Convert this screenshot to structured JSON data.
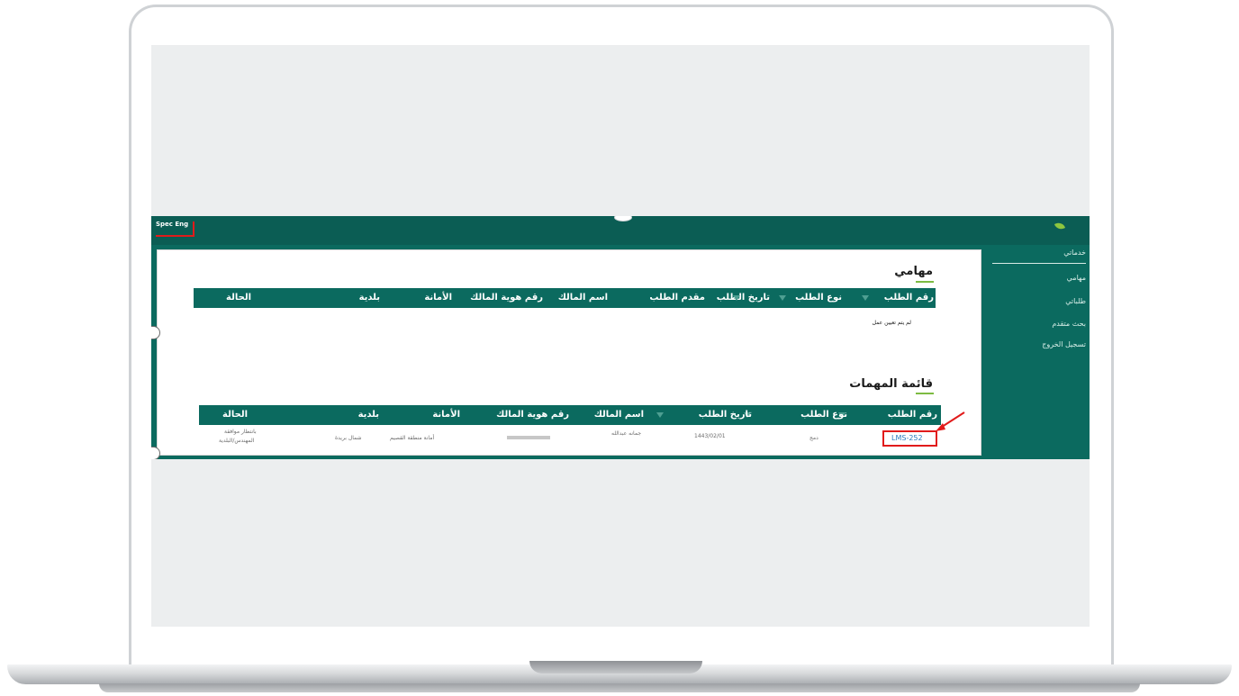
{
  "app": {
    "user_label": "Spec Eng"
  },
  "sidebar": {
    "items": [
      {
        "label": "خدماتي"
      },
      {
        "label": "مهامي"
      },
      {
        "label": "طلباتي"
      },
      {
        "label": "بحث متقدم"
      },
      {
        "label": "تسجيل الخروج"
      }
    ]
  },
  "tasks": {
    "title": "مهامي",
    "columns": [
      "رقم الطلب",
      "نوع الطلب",
      "تاريخ الطلب",
      "مقدم الطلب",
      "اسم المالك",
      "رقم هوية المالك",
      "الأمانة",
      "بلدية",
      "الحالة"
    ],
    "empty_message": "لم يتم تعيين عمل"
  },
  "task_list": {
    "title": "قائمة المهمات",
    "columns": [
      "رقم الطلب",
      "نوع الطلب",
      "تاريخ الطلب",
      "اسم المالك",
      "رقم هوية المالك",
      "الأمانة",
      "بلدية",
      "الحالة"
    ],
    "rows": [
      {
        "request_no": "LMS-252",
        "type": "دمج",
        "date": "1443/02/01",
        "owner": "جمانه عبدالله",
        "amana": "أمانة منطقة القصيم",
        "municipality": "شمال بريدة",
        "status_line1": "بانتظار موافقة",
        "status_line2": "المهندس/البلدية"
      }
    ]
  },
  "colors": {
    "primary": "#0b6a5f",
    "accent": "#7dbb42",
    "highlight": "#e11b1b"
  }
}
